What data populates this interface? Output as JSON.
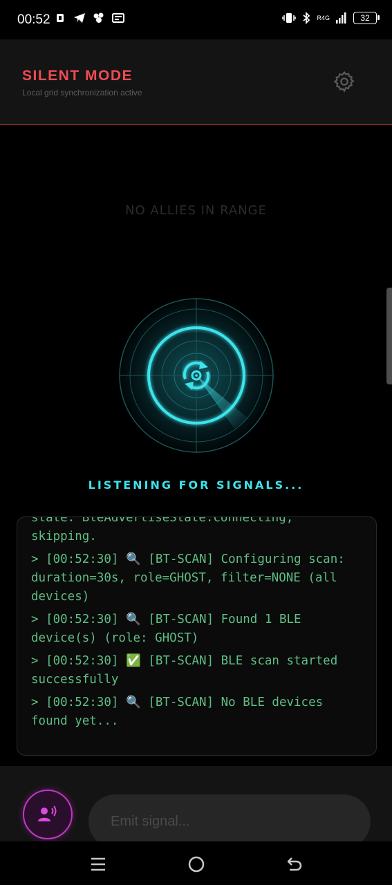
{
  "status_bar": {
    "time": "00:52",
    "network_label": "R4G",
    "battery": "32"
  },
  "header": {
    "title": "SILENT MODE",
    "subtitle": "Local grid synchronization active"
  },
  "main": {
    "empty_state": "NO ALLIES IN RANGE",
    "listening_text": "LISTENING FOR SIGNALS..."
  },
  "log": {
    "partial": "state: BleAdvertiseState.connecting,\nskipping.",
    "lines": [
      "> [00:52:30] 🔍 [BT-SCAN] Configuring scan: duration=30s, role=GHOST, filter=NONE (all devices)",
      "> [00:52:30] 🔍 [BT-SCAN] Found 1 BLE device(s) (role: GHOST)",
      "> [00:52:30] ✅ [BT-SCAN] BLE scan started successfully",
      "> [00:52:30] 🔍 [BT-SCAN] No BLE devices found yet..."
    ]
  },
  "input": {
    "placeholder": "Emit signal..."
  },
  "colors": {
    "accent_red": "#ee4b52",
    "accent_cyan": "#3ee3ec",
    "log_green": "#5fbe84",
    "voice_magenta": "#c534c8"
  },
  "icons": {
    "settings": "gear-icon",
    "voice": "voice-broadcast-icon",
    "radar": "radar-sync-icon",
    "nav_menu": "menu-icon",
    "nav_home": "home-icon",
    "nav_back": "back-icon"
  }
}
